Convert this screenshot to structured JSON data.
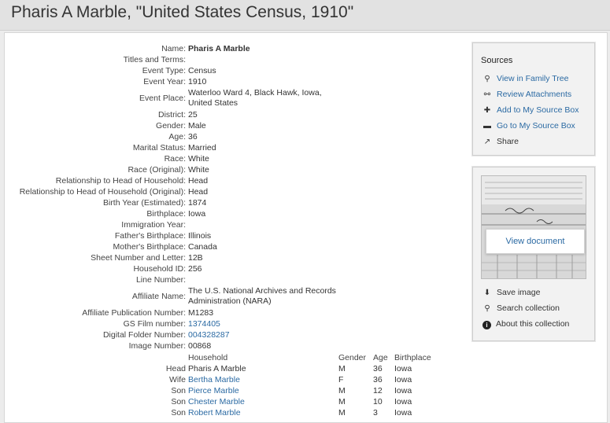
{
  "page": {
    "title": "Pharis A Marble, \"United States Census, 1910\""
  },
  "record": {
    "fields": [
      {
        "label": "Name:",
        "value": "Pharis A Marble",
        "style": "bold"
      },
      {
        "label": "Titles and Terms:",
        "value": ""
      },
      {
        "label": "Event Type:",
        "value": "Census"
      },
      {
        "label": "Event Year:",
        "value": "1910"
      },
      {
        "label": "Event Place:",
        "value": "Waterloo Ward 4, Black Hawk, Iowa,",
        "value2": "United States"
      },
      {
        "label": "District:",
        "value": "25"
      },
      {
        "label": "Gender:",
        "value": "Male"
      },
      {
        "label": "Age:",
        "value": "36"
      },
      {
        "label": "Marital Status:",
        "value": "Married"
      },
      {
        "label": "Race:",
        "value": "White"
      },
      {
        "label": "Race (Original):",
        "value": "White"
      },
      {
        "label": "Relationship to Head of Household:",
        "value": "Head"
      },
      {
        "label": "Relationship to Head of Household (Original):",
        "value": "Head"
      },
      {
        "label": "Birth Year (Estimated):",
        "value": "1874"
      },
      {
        "label": "Birthplace:",
        "value": "Iowa"
      },
      {
        "label": "Immigration Year:",
        "value": ""
      },
      {
        "label": "Father's Birthplace:",
        "value": "Illinois"
      },
      {
        "label": "Mother's Birthplace:",
        "value": "Canada"
      },
      {
        "label": "Sheet Number and Letter:",
        "value": "12B"
      },
      {
        "label": "Household ID:",
        "value": "256"
      },
      {
        "label": "Line Number:",
        "value": ""
      },
      {
        "label": "Affiliate Name:",
        "value": "The U.S. National Archives and Records",
        "value2": "Administration (NARA)"
      },
      {
        "label": "Affiliate Publication Number:",
        "value": "M1283"
      },
      {
        "label": "GS Film number:",
        "value": "1374405",
        "style": "link"
      },
      {
        "label": "Digital Folder Number:",
        "value": "004328287",
        "style": "link"
      },
      {
        "label": "Image Number:",
        "value": "00868"
      }
    ]
  },
  "household": {
    "headers": {
      "name": "Household",
      "gender": "Gender",
      "age": "Age",
      "birthplace": "Birthplace"
    },
    "members": [
      {
        "relation": "Head",
        "name": "Pharis A Marble",
        "gender": "M",
        "age": "36",
        "birthplace": "Iowa",
        "link": false
      },
      {
        "relation": "Wife",
        "name": "Bertha Marble",
        "gender": "F",
        "age": "36",
        "birthplace": "Iowa",
        "link": true
      },
      {
        "relation": "Son",
        "name": "Pierce Marble",
        "gender": "M",
        "age": "12",
        "birthplace": "Iowa",
        "link": true
      },
      {
        "relation": "Son",
        "name": "Chester Marble",
        "gender": "M",
        "age": "10",
        "birthplace": "Iowa",
        "link": true
      },
      {
        "relation": "Son",
        "name": "Robert Marble",
        "gender": "M",
        "age": "3",
        "birthplace": "Iowa",
        "link": true
      }
    ]
  },
  "sources": {
    "title": "Sources",
    "items": [
      {
        "label": "View in Family Tree",
        "icon": "paperclip-icon",
        "glyph": "⚲"
      },
      {
        "label": "Review Attachments",
        "icon": "attachments-icon",
        "glyph": "⚯"
      },
      {
        "label": "Add to My Source Box",
        "icon": "plus-box-icon",
        "glyph": "✚"
      },
      {
        "label": "Go to My Source Box",
        "icon": "source-box-icon",
        "glyph": "▬"
      },
      {
        "label": "Share",
        "icon": "share-icon",
        "glyph": "↗"
      }
    ]
  },
  "document": {
    "view_label": "View document",
    "actions": [
      {
        "label": "Save image",
        "icon": "download-icon",
        "glyph": "⬇"
      },
      {
        "label": "Search collection",
        "icon": "search-icon",
        "glyph": "⚲"
      },
      {
        "label": "About this collection",
        "icon": "info-icon",
        "glyph": "i"
      }
    ]
  },
  "colors": {
    "link": "#2b6aa3",
    "text": "#333333",
    "panel": "#f2f2f2",
    "background": "#ececec"
  }
}
